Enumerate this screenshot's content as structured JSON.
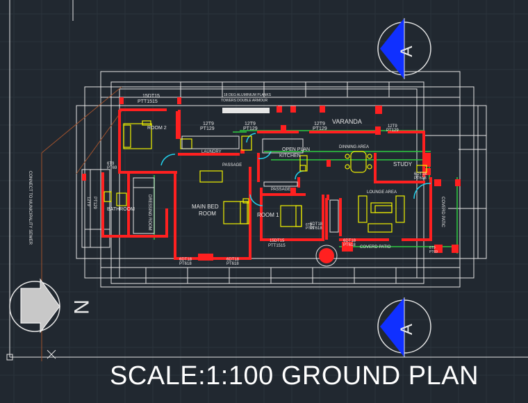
{
  "drawing": {
    "scale_title": "SCALE:1:100 GROUND PLAN",
    "north_label": "N",
    "section_marker": "A",
    "side_note": "CONNECT TO MUNICIPALITY SEWER"
  },
  "rooms": {
    "room2": "ROOM 2",
    "laundry": "LAUNDRY",
    "passage1": "PASSAGE",
    "passage2": "PASSAGE",
    "main_bed": "MAIN BED",
    "main_bed_2": "ROOM",
    "bathroom": "BATHROOM",
    "dressing": "DRESSING ROOM",
    "room1": "ROOM 1",
    "open_plan": "OPEN PLAN",
    "kitchen": "KITCHEN",
    "dinning": "DINNING AREA",
    "study": "STUDY",
    "lounge": "LOUNGE AREA",
    "varanda": "VARANDA",
    "covered_patio": "COVERD PATIO",
    "covered_patio_right": "COVERD PATIC"
  },
  "window_tags": {
    "w1": "15DT15",
    "w1b": "PTT1515",
    "w2": "12T9",
    "w2b": "PT129",
    "w3": "12T9",
    "w3b": "PT129",
    "w4": "12T9",
    "w4b": "PT129",
    "w5": "12T9",
    "w5b": "PT129",
    "w6": "6T9",
    "w6b": "PT69",
    "w7": "12T9",
    "w7b": "PT129",
    "w8": "6DT18",
    "w8b": "PT618",
    "w9": "6DT18",
    "w9b": "PT618",
    "w10": "15DT15",
    "w10b": "PTT1515",
    "w11": "6DT18",
    "w11b": "PT618",
    "w12": "6DT18",
    "w12b": "PT618",
    "w13": "6DT18",
    "w13b": "PT618",
    "w14": "6T9",
    "w14b": "PT69",
    "w15": "6T9",
    "w15b": "PT69"
  },
  "notes": {
    "note1": "18 DEG ALUMINIUM PLANKS",
    "note2": "TOWERS DOUBLE ARMOUR"
  },
  "colors": {
    "background": "#212830",
    "wall": "#ff2020",
    "furniture": "#f2f200",
    "line": "#e6e6e6",
    "green": "#2ecc40",
    "cyan": "#22d3ee",
    "marker_blue": "#1030ff"
  }
}
